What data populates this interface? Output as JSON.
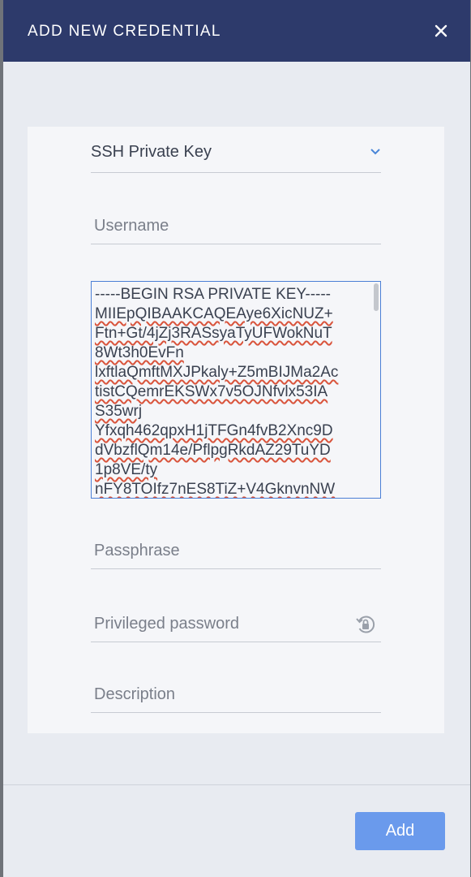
{
  "dialog": {
    "title": "ADD NEW CREDENTIAL",
    "close_icon": "close-icon",
    "header_color": "#2d3a6b",
    "accent_color": "#6a9aec"
  },
  "form": {
    "credential_type": {
      "selected": "SSH Private Key",
      "icon": "chevron-down-icon"
    },
    "username": {
      "placeholder": "Username",
      "value": ""
    },
    "private_key": {
      "lines": [
        "-----BEGIN RSA PRIVATE KEY-----",
        "MIIEpQIBAAKCAQEAye6XicNUZ+",
        "Ftn+Gt/4jZj3RASsyaTyUFWokNuT",
        "8Wt3h0EvFn",
        "lxftlaQmftMXJPkaly+Z5mBIJMa2Ac",
        "tistCQemrEKSWx7v5OJNfvlx53IA",
        "S35wrj",
        "Yfxqh462qpxH1jTFGn4fvB2Xnc9D",
        "dVbzflQm14e/PflpgRkdAZ29TuYD",
        "1p8VE/ty",
        "nFY8TOIfz7nES8TiZ+V4GknvnNW"
      ]
    },
    "passphrase": {
      "placeholder": "Passphrase",
      "value": ""
    },
    "privileged_password": {
      "placeholder": "Privileged password",
      "value": "",
      "icon": "lock-refresh-icon"
    },
    "description": {
      "placeholder": "Description",
      "value": ""
    }
  },
  "footer": {
    "add_label": "Add"
  }
}
